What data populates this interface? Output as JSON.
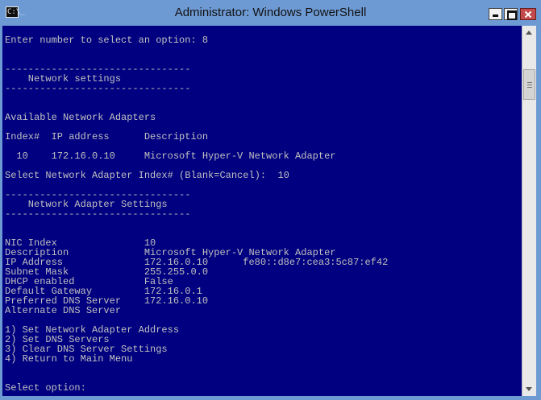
{
  "window": {
    "title": "Administrator: Windows PowerShell",
    "icon": "C:\\_"
  },
  "controls": {
    "minimize_icon": "minimize-icon",
    "maximize_icon": "maximize-icon",
    "close_icon": "close-icon"
  },
  "console": {
    "lines": [
      "Enter number to select an option: 8",
      "",
      "",
      "--------------------------------",
      "    Network settings",
      "--------------------------------",
      "",
      "",
      "Available Network Adapters",
      "",
      "Index#  IP address      Description",
      "",
      "  10    172.16.0.10     Microsoft Hyper-V Network Adapter",
      "",
      "Select Network Adapter Index# (Blank=Cancel):  10",
      "",
      "--------------------------------",
      "    Network Adapter Settings",
      "--------------------------------",
      "",
      "",
      "NIC Index               10",
      "Description             Microsoft Hyper-V Network Adapter",
      "IP Address              172.16.0.10      fe80::d8e7:cea3:5c87:ef42",
      "Subnet Mask             255.255.0.0",
      "DHCP enabled            False",
      "Default Gateway         172.16.0.1",
      "Preferred DNS Server    172.16.0.10",
      "Alternate DNS Server",
      "",
      "1) Set Network Adapter Address",
      "2) Set DNS Servers",
      "3) Clear DNS Server Settings",
      "4) Return to Main Menu",
      "",
      "",
      "Select option:"
    ]
  },
  "colors": {
    "console_background": "#000080",
    "console_text": "#c0c0c0",
    "window_frame": "#6e9ad4",
    "close_button": "#c44b4b"
  },
  "scrollbar": {
    "scroll_position": 0.12
  }
}
